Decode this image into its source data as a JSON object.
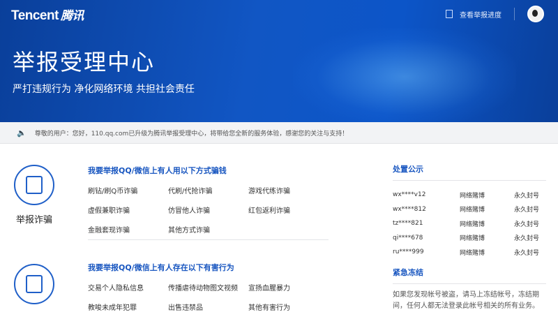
{
  "header": {
    "brand_en": "Tencent",
    "brand_cn": "腾讯",
    "progress_link": "查看举报进度"
  },
  "hero": {
    "title": "举报受理中心",
    "subtitle": "严打违规行为 净化网络环境 共担社会责任"
  },
  "notice": {
    "text": "尊敬的用户：您好，110.qq.com已升级为腾讯举报受理中心，将带给您全新的服务体验，感谢您的关注与支持！"
  },
  "categories": [
    {
      "label": "举报诈骗",
      "title": "我要举报QQ/微信上有人用以下方式骗钱",
      "items": [
        "刷钻/刷Q币诈骗",
        "代刷/代抢诈骗",
        "游戏代练诈骗",
        "虚假兼职诈骗",
        "仿冒他人诈骗",
        "红包返利诈骗",
        "金融套现诈骗",
        "其他方式诈骗"
      ]
    },
    {
      "label": "",
      "title": "我要举报QQ/微信上有人存在以下有害行为",
      "items": [
        "交易个人隐私信息",
        "传播虐待动物图文视频",
        "宣扬血腥暴力",
        "教唆未成年犯罪",
        "出售违禁品",
        "其他有害行为"
      ]
    }
  ],
  "sidebar": {
    "disposal_title": "处置公示",
    "records": [
      {
        "account": "wx****v12",
        "reason": "网络賭博",
        "penalty": "永久封号"
      },
      {
        "account": "wx****812",
        "reason": "网络賭博",
        "penalty": "永久封号"
      },
      {
        "account": "tz****821",
        "reason": "网络賭博",
        "penalty": "永久封号"
      },
      {
        "account": "qi****678",
        "reason": "网络賭博",
        "penalty": "永久封号"
      },
      {
        "account": "ru****999",
        "reason": "网络賭博",
        "penalty": "永久封号"
      }
    ],
    "freeze_title": "紧急冻结",
    "freeze_text": "如果您发现帐号被盗，请马上冻结帐号，冻结期间，任何人都无法登录此帐号相关的所有业务。"
  }
}
